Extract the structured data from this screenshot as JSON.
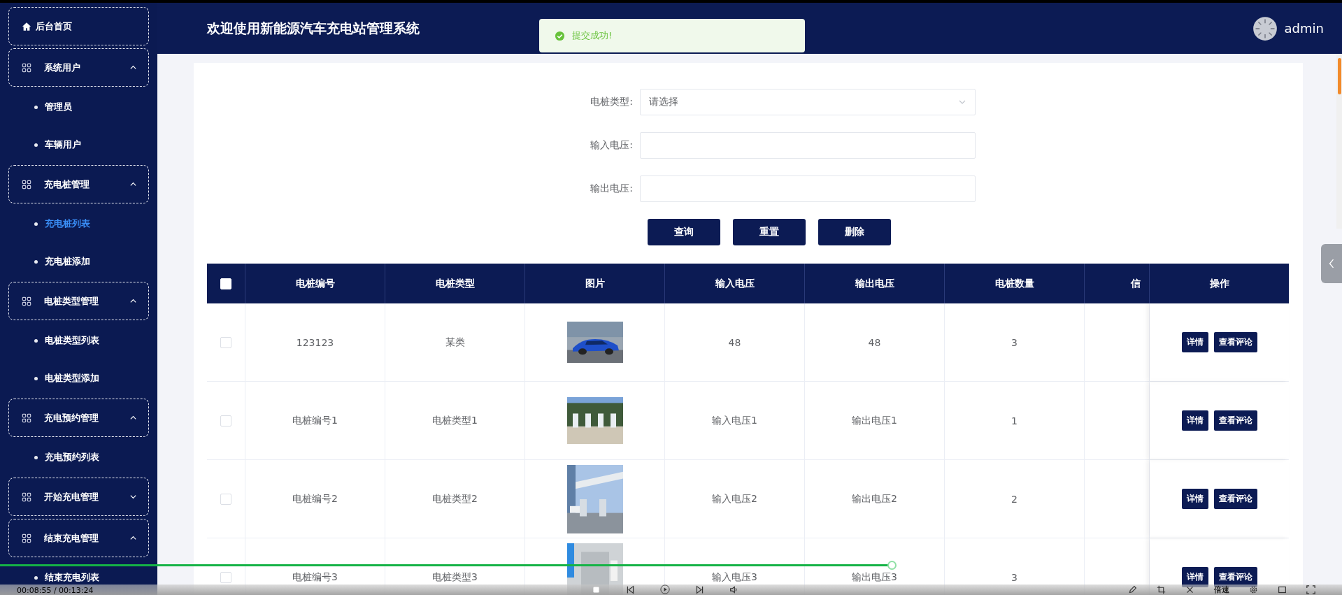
{
  "sidebar": {
    "items": [
      {
        "label": "后台首页",
        "kind": "home"
      },
      {
        "label": "系统用户",
        "kind": "group",
        "expanded": true,
        "children": [
          {
            "label": "管理员",
            "selected": false
          },
          {
            "label": "车辆用户",
            "selected": false
          }
        ]
      },
      {
        "label": "充电桩管理",
        "kind": "group",
        "expanded": true,
        "children": [
          {
            "label": "充电桩列表",
            "selected": true
          },
          {
            "label": "充电桩添加",
            "selected": false
          }
        ]
      },
      {
        "label": "电桩类型管理",
        "kind": "group",
        "expanded": true,
        "children": [
          {
            "label": "电桩类型列表",
            "selected": false
          },
          {
            "label": "电桩类型添加",
            "selected": false
          }
        ]
      },
      {
        "label": "充电预约管理",
        "kind": "group",
        "expanded": true,
        "children": [
          {
            "label": "充电预约列表",
            "selected": false
          }
        ]
      },
      {
        "label": "开始充电管理",
        "kind": "group",
        "expanded": false
      },
      {
        "label": "结束充电管理",
        "kind": "group",
        "expanded": true,
        "children": [
          {
            "label": "结束充电列表",
            "selected": false
          }
        ]
      }
    ]
  },
  "header": {
    "title": "欢迎使用新能源汽车充电站管理系统",
    "toast": "提交成功!",
    "user": "admin"
  },
  "form": {
    "fields": [
      {
        "label": "电桩类型:",
        "kind": "select",
        "placeholder": "请选择"
      },
      {
        "label": "输入电压:",
        "kind": "input"
      },
      {
        "label": "输出电压:",
        "kind": "input"
      }
    ],
    "buttons": [
      "查询",
      "重置",
      "删除"
    ]
  },
  "table": {
    "all_checked": false,
    "columns": [
      "电桩编号",
      "电桩类型",
      "图片",
      "输入电压",
      "输出电压",
      "电桩数量",
      "信"
    ],
    "actions_column": "操作",
    "rows": [
      {
        "checked": false,
        "cells": [
          "123123",
          "某类",
          {
            "kind": "picture"
          },
          "48",
          "48",
          "3"
        ],
        "actions": [
          "详情",
          "查看评论"
        ]
      },
      {
        "checked": false,
        "cells": [
          "电桩编号1",
          "电桩类型1",
          {
            "kind": "picture"
          },
          "输入电压1",
          "输出电压1",
          "1"
        ],
        "actions": [
          "详情",
          "查看评论"
        ]
      },
      {
        "checked": false,
        "cells": [
          "电桩编号2",
          "电桩类型2",
          {
            "kind": "picture"
          },
          "输入电压2",
          "输出电压2",
          "2"
        ],
        "actions": [
          "详情",
          "查看评论"
        ]
      },
      {
        "checked": false,
        "cells": [
          "电桩编号3",
          "电桩类型3",
          {
            "kind": "picture"
          },
          "输入电压3",
          "输出电压3",
          "3"
        ],
        "actions": [
          "详情",
          "查看评论"
        ]
      }
    ]
  },
  "video": {
    "time": "00:08:55 / 00:13:24",
    "progress": {
      "level": 0.665
    },
    "speed_label": "倍速"
  }
}
